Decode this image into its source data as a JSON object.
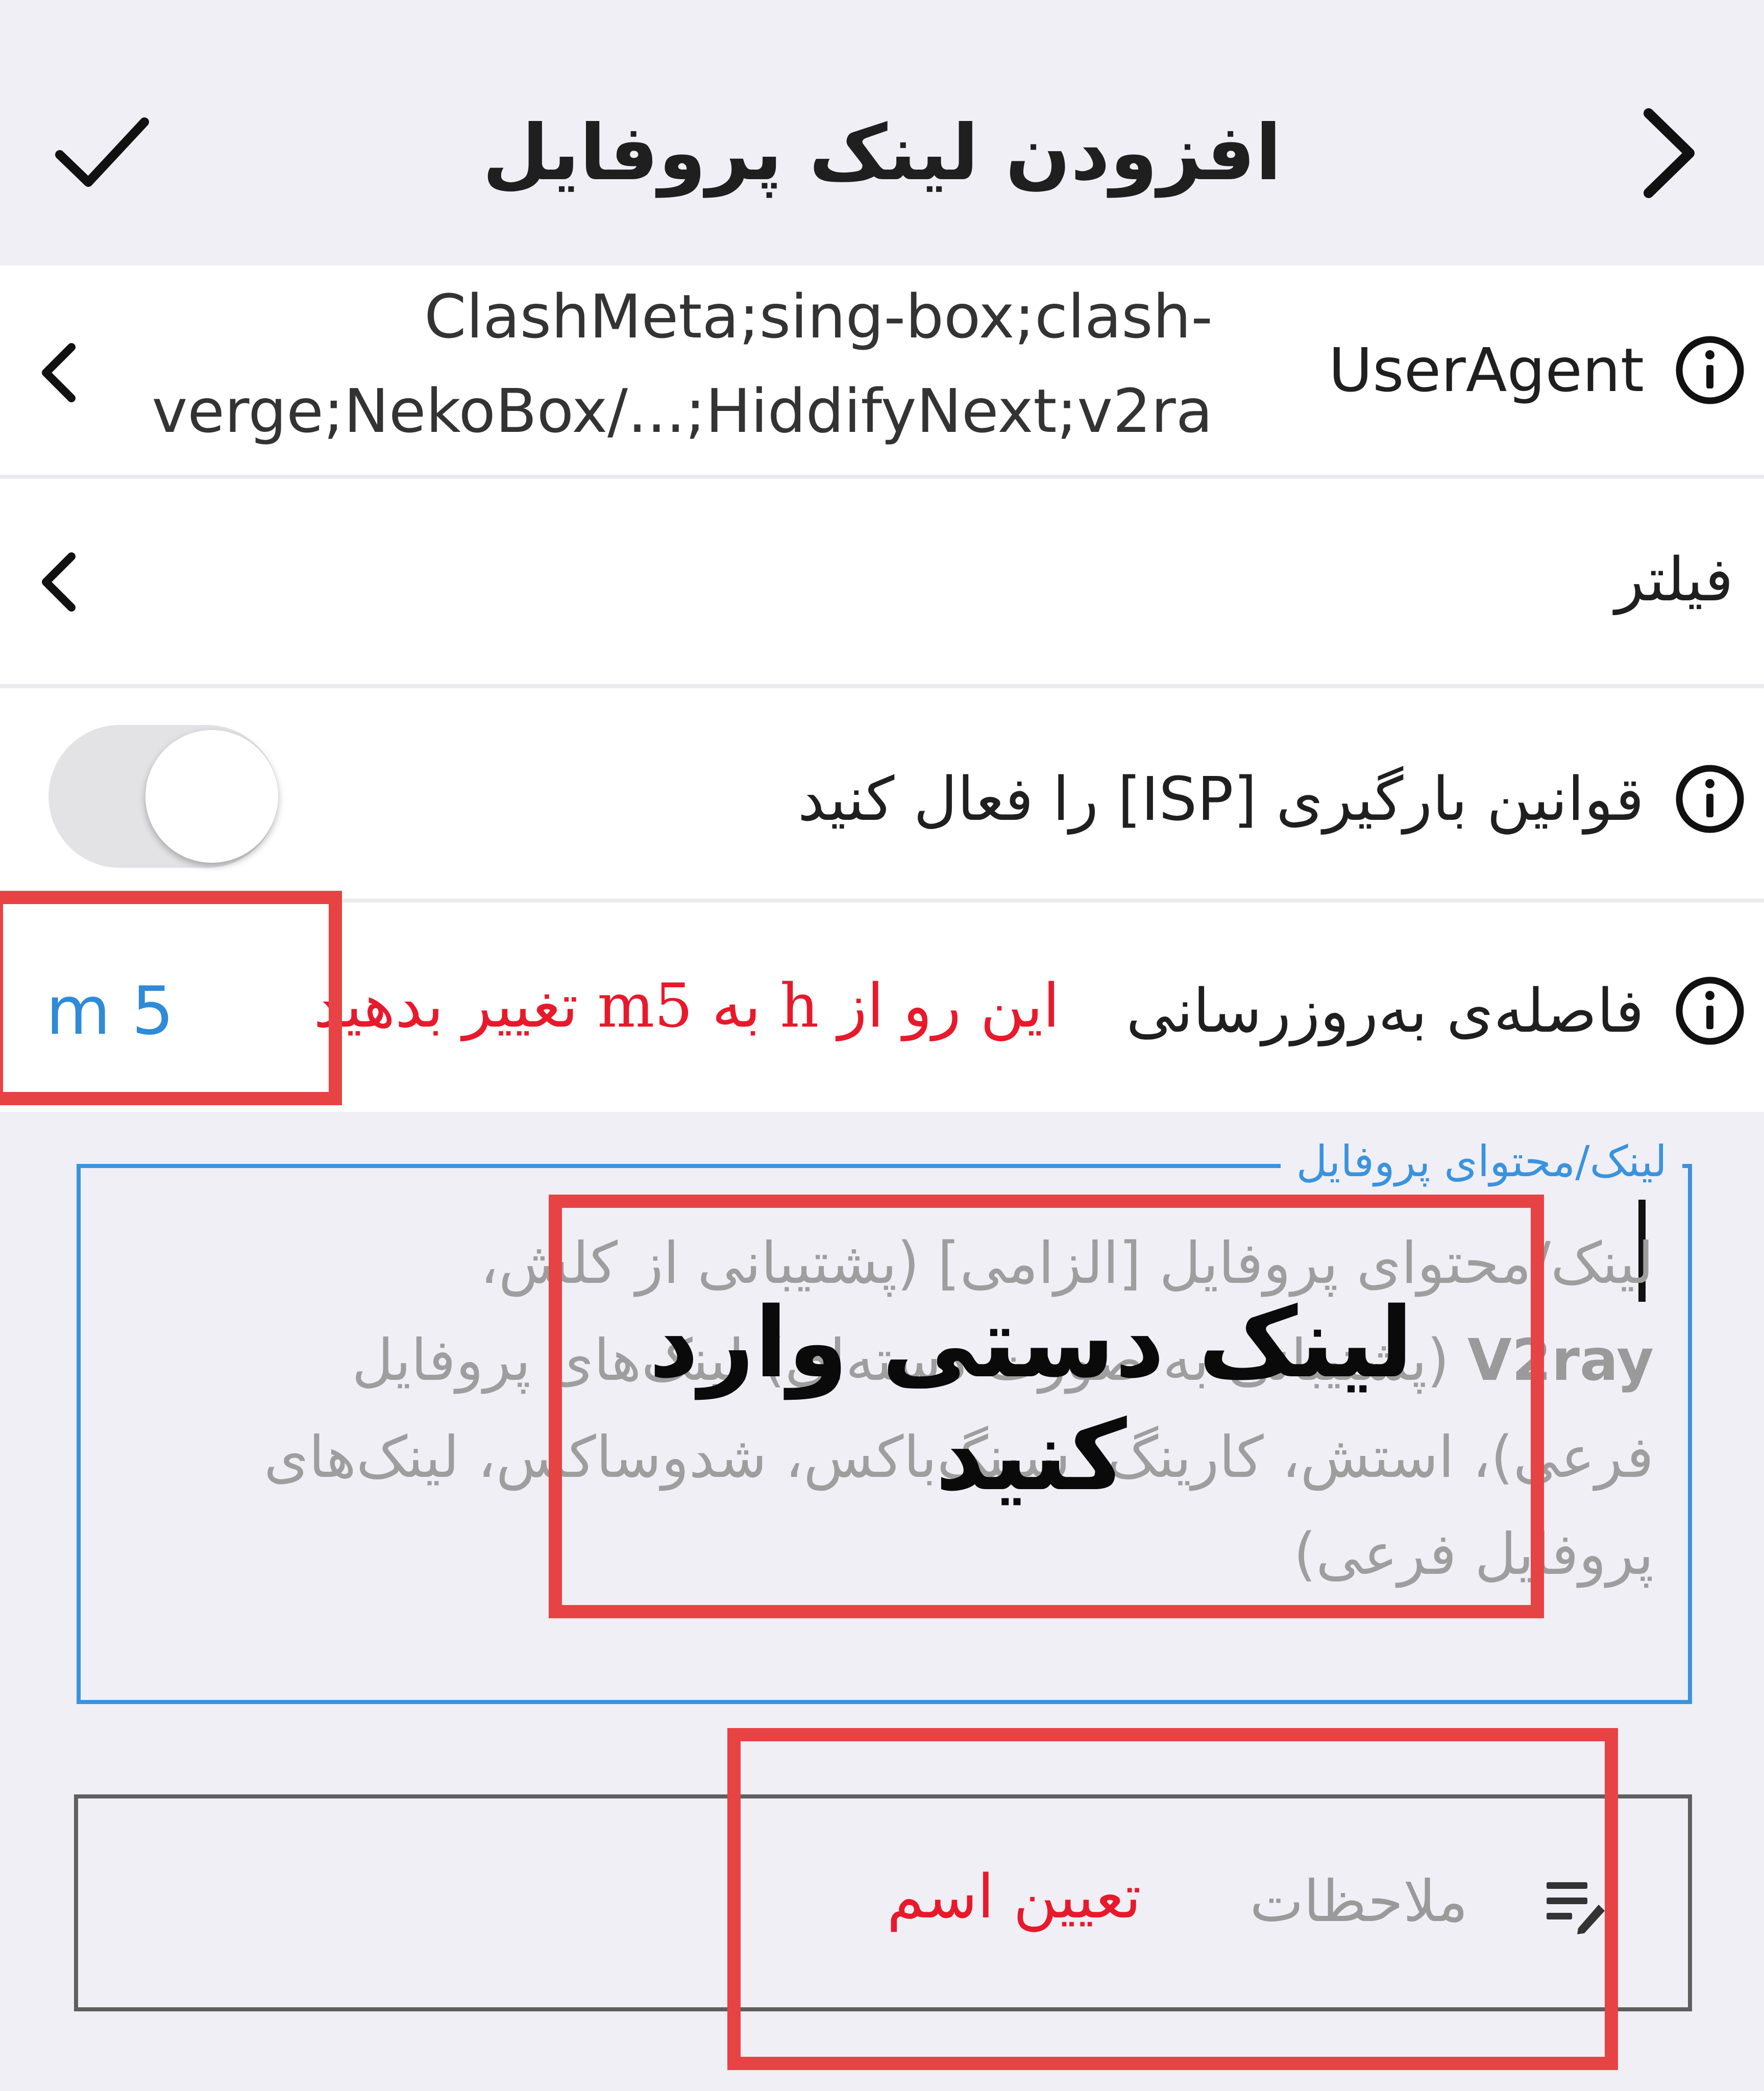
{
  "header": {
    "title": "افزودن لینک پروفایل",
    "confirm_icon": "checkmark-icon",
    "back_icon": "chevron-right-icon"
  },
  "settings": {
    "user_agent": {
      "label": "UserAgent",
      "value_line1": "ClashMeta;sing-box;clash-",
      "value_line2": "verge;NekoBox/...;HiddifyNext;v2ra"
    },
    "filter": {
      "label": "فیلتر"
    },
    "isp_rules": {
      "label": "قوانین بارگیری [ISP] را فعال کنید",
      "enabled": false
    },
    "update_interval": {
      "label": "فاصله‌ی به‌روزرسانی",
      "value": "m 5"
    }
  },
  "profile_link": {
    "legend": "لینک/محتوای پروفایل",
    "placeholder_lines": [
      "لینک/محتوای پروفایل [الزامی] (پشتیبانی از کلش،",
      "(پشتیبانی به صورت دسته‌ای) لینک‌های پروفایل",
      "فرعی)، استش، کارینگ، سینگ‌باکس، شدوساکس، لینک‌های",
      "پروفایل فرعی)"
    ],
    "placeholder_bold": "V2ray"
  },
  "notes": {
    "placeholder": "ملاحظات"
  },
  "annotations": {
    "interval_hint": "این رو از h به m5 تغییر بدهید",
    "link_hint": "لینک دستی  وارد کنید",
    "name_hint": "تعیین اسم",
    "color": "#e74345"
  }
}
